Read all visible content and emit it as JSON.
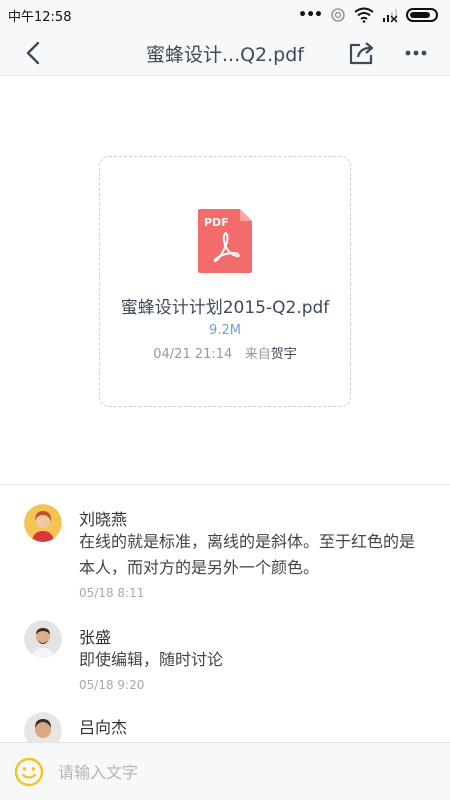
{
  "status_bar": {
    "time": "中午12:58",
    "dots": "•••"
  },
  "nav": {
    "title": "蜜蜂设计...Q2.pdf"
  },
  "file": {
    "icon_label": "PDF",
    "name": "蜜蜂设计计划2015-Q2.pdf",
    "size": "9.2M",
    "date": "04/21  21:14",
    "from_prefix": "来自",
    "from_user": "贺宇"
  },
  "comments": [
    {
      "name": "刘晓燕",
      "text": "在线的就是标准，离线的是斜体。至于红色的是本人，而对方的是另外一个颜色。",
      "time": "05/18 8:11"
    },
    {
      "name": "张盛",
      "text": "即使编辑，随时讨论",
      "time": "05/18 9:20"
    },
    {
      "name": "吕向杰"
    }
  ],
  "input": {
    "placeholder": "请输入文字"
  },
  "colors": {
    "pdf_red": "#f36c6c",
    "accent_blue": "#6ba3d9",
    "emoji_yellow": "#f5c518"
  }
}
